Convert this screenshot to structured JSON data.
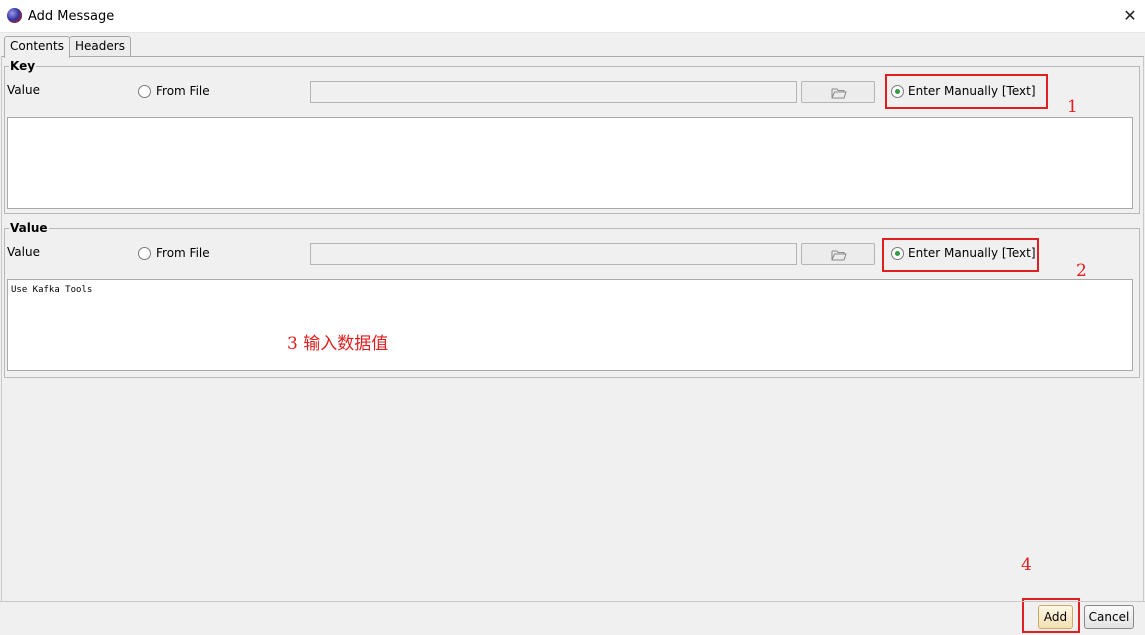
{
  "window": {
    "title": "Add Message",
    "close_symbol": "✕"
  },
  "tabs": [
    {
      "label": "Contents",
      "active": true
    },
    {
      "label": "Headers",
      "active": false
    }
  ],
  "key_panel": {
    "legend": "Key",
    "value_label": "Value",
    "from_file_label": "From File",
    "from_file_selected": false,
    "file_path": "",
    "enter_manually_label": "Enter Manually [Text]",
    "enter_manually_selected": true,
    "text": ""
  },
  "value_panel": {
    "legend": "Value",
    "value_label": "Value",
    "from_file_label": "From File",
    "from_file_selected": false,
    "file_path": "",
    "enter_manually_label": "Enter Manually [Text]",
    "enter_manually_selected": true,
    "text": "Use Kafka Tools"
  },
  "annotations": {
    "step1": "1",
    "step2": "2",
    "step3": "3 输入数据值",
    "step4": "4",
    "color": "#e02020"
  },
  "buttons": {
    "add": "Add",
    "cancel": "Cancel"
  },
  "icons": {
    "app": "app-icon",
    "browse": "folder-open-icon",
    "close": "close-icon"
  },
  "colors": {
    "radio_selected": "#2e9b3e",
    "background": "#f0f0f0"
  }
}
